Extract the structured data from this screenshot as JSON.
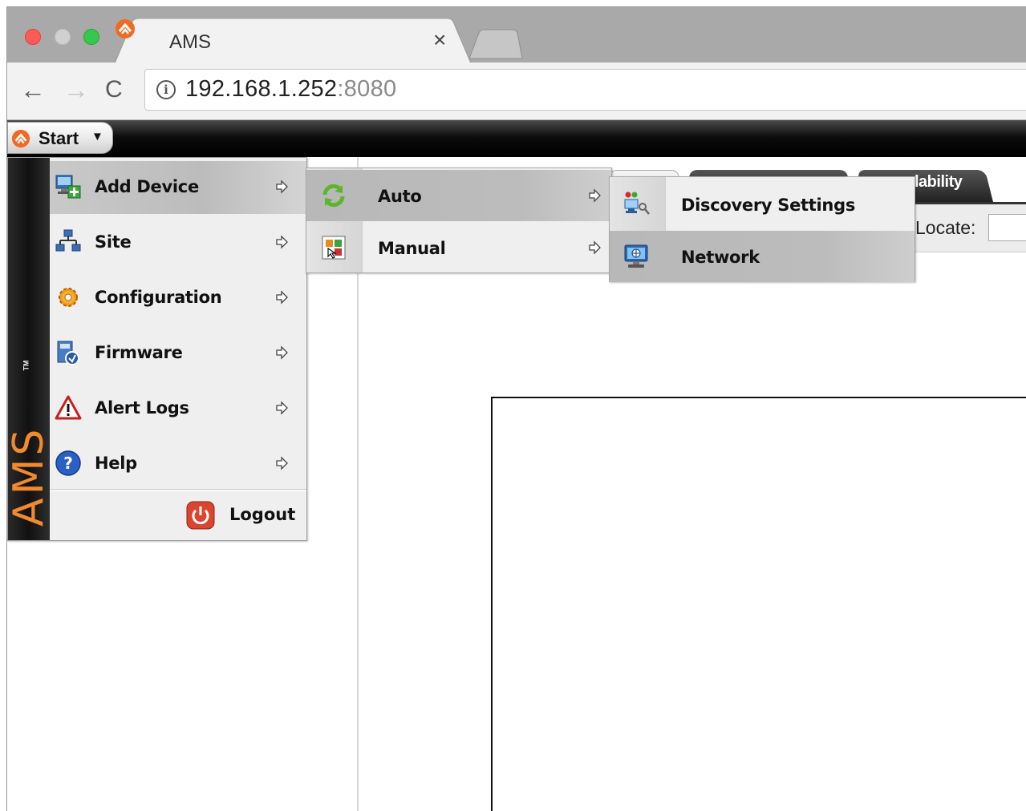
{
  "browser": {
    "tab_title": "AMS",
    "url_host": "192.168.1.252",
    "url_port": ":8080"
  },
  "taskbar": {
    "start_label": "Start"
  },
  "start_menu": {
    "brand": "AMS",
    "brand_tm": "TM",
    "items": [
      {
        "label": "Add Device",
        "icon": "add-device-icon"
      },
      {
        "label": "Site",
        "icon": "site-network-icon"
      },
      {
        "label": "Configuration",
        "icon": "gear-icon"
      },
      {
        "label": "Firmware",
        "icon": "firmware-icon"
      },
      {
        "label": "Alert Logs",
        "icon": "warning-icon"
      },
      {
        "label": "Help",
        "icon": "help-icon"
      }
    ],
    "logout_label": "Logout"
  },
  "add_device_submenu": {
    "items": [
      {
        "label": "Auto",
        "icon": "refresh-icon"
      },
      {
        "label": "Manual",
        "icon": "manual-icon"
      }
    ]
  },
  "auto_submenu": {
    "items": [
      {
        "label": "Discovery Settings",
        "icon": "discovery-settings-icon"
      },
      {
        "label": "Network",
        "icon": "network-icon"
      }
    ]
  },
  "background": {
    "tab_label": "lability",
    "locate_label": "Locate:"
  }
}
